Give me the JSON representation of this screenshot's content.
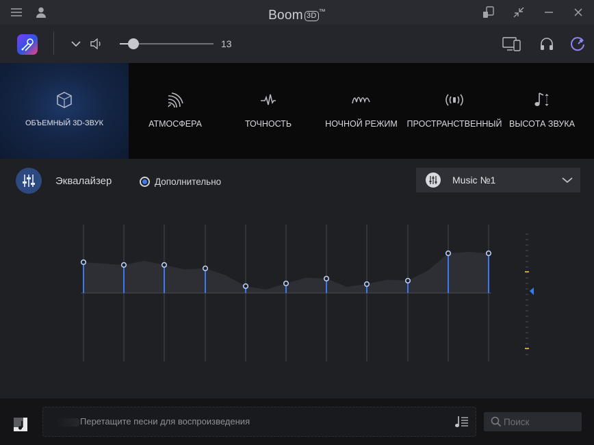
{
  "window": {
    "title_word": "Boom",
    "title_badge": "3D",
    "title_tm": "™",
    "menu_icon": "hamburger-icon",
    "account_icon": "user-icon",
    "remote_icon": "remote-icon",
    "minimize_mode_icon": "collapse-arrows-icon",
    "minimize_icon": "minimize-icon",
    "close_icon": "close-icon"
  },
  "toolbar": {
    "volume_value": "13",
    "volume_level": 13
  },
  "effects": [
    {
      "id": "3d",
      "label": "ОБЪЕМНЫЙ 3D-ЗВУК",
      "icon": "cube-icon",
      "active": true
    },
    {
      "id": "ambience",
      "label": "АТМОСФЕРА",
      "icon": "ambience-icon",
      "active": false
    },
    {
      "id": "fidelity",
      "label": "ТОЧНОСТЬ",
      "icon": "fidelity-icon",
      "active": false
    },
    {
      "id": "night",
      "label": "НОЧНОЙ РЕЖИМ",
      "icon": "night-mode-icon",
      "active": false
    },
    {
      "id": "spatial",
      "label": "ПРОСТРАНСТВЕННЫЙ",
      "icon": "spatial-icon",
      "active": false
    },
    {
      "id": "pitch",
      "label": "ВЫСОТА ЗВУКА",
      "icon": "pitch-icon",
      "active": false
    }
  ],
  "equalizer": {
    "title": "Эквалайзер",
    "advanced_label": "Дополнительно",
    "advanced_selected": true,
    "preset": "Music №1",
    "bands": [
      0.45,
      0.41,
      0.41,
      0.36,
      0.1,
      0.14,
      0.21,
      0.13,
      0.18,
      0.58,
      0.58
    ],
    "accent_color": "#3a7bf0"
  },
  "bottom": {
    "drop_text": "Перетащите песни для воспроизведения",
    "search_placeholder": "Поиск"
  },
  "colors": {
    "accent": "#3a7bf0",
    "marker": "#c8a33a"
  }
}
